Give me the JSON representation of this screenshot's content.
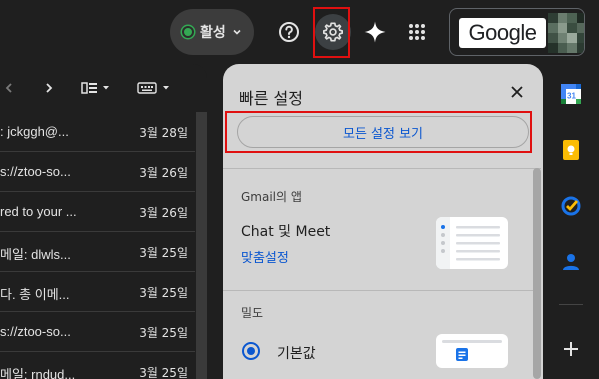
{
  "header": {
    "status_label": "활성",
    "status_color": "#34a853",
    "icons": [
      "help-icon",
      "gear-icon",
      "gemini-spark-icon",
      "apps-grid-icon"
    ],
    "account_logo_text": "Google"
  },
  "toolbar": {
    "icons": [
      "chevron-left-icon",
      "chevron-right-icon",
      "split-pane-icon",
      "keyboard-icon"
    ]
  },
  "emails": [
    {
      "sender": ": jckggh@...",
      "date": "3월 28일"
    },
    {
      "sender": "s://ztoo-so...",
      "date": "3월 26일"
    },
    {
      "sender": "red to your ...",
      "date": "3월 26일"
    },
    {
      "sender": "메일: dlwls...",
      "date": "3월 25일"
    },
    {
      "sender": "다. 총 이메...",
      "date": "3월 25일"
    },
    {
      "sender": "s://ztoo-so...",
      "date": "3월 25일"
    },
    {
      "sender": "메일: rndud...",
      "date": "3월 25일"
    }
  ],
  "quick_settings": {
    "title": "빠른 설정",
    "all_settings_button": "모든 설정 보기",
    "apps_section_label": "Gmail의 앱",
    "chat_meet_label": "Chat 및 Meet",
    "customize_link": "맞춤설정",
    "density_section_label": "밀도",
    "density_default_label": "기본값",
    "density_default_selected": true,
    "accent_color": "#0b57d0"
  },
  "side_panel": {
    "icons": [
      "google-calendar-icon",
      "google-keep-icon",
      "google-tasks-icon",
      "google-contacts-icon",
      "add-icon"
    ]
  }
}
